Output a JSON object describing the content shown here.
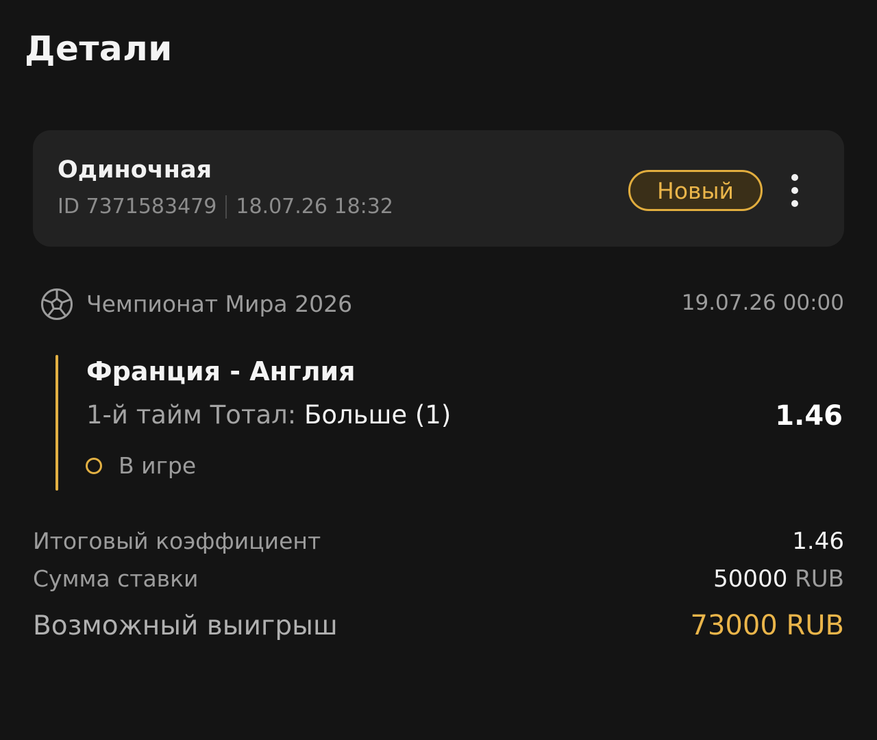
{
  "page": {
    "title": "Детали"
  },
  "bet": {
    "type": "Одиночная",
    "id_text": "ID 7371583479",
    "placed_at": "18.07.26 18:32",
    "status_badge": "Новый",
    "more_icon": "more-vertical-icon"
  },
  "event": {
    "sport_icon": "soccer-ball-icon",
    "tournament": "Чемпионат Мира 2026",
    "date": "19.07.26 00:00",
    "match": "Франция - Англия",
    "market_label": "1-й тайм Тотал: ",
    "outcome": "Больше (1)",
    "odds": "1.46",
    "live_status": "В игре"
  },
  "summary": {
    "total_odds_label": "Итоговый коэффициент",
    "total_odds_value": "1.46",
    "stake_label": "Сумма ставки",
    "stake_amount": "50000",
    "stake_currency": "RUB",
    "payout_label": "Возможный выигрыш",
    "payout_value": "73000 RUB"
  },
  "colors": {
    "background": "#141414",
    "card": "#222222",
    "accent": "#e2b043",
    "text_primary": "#f4f4f4",
    "text_secondary": "#9c9c9c"
  }
}
